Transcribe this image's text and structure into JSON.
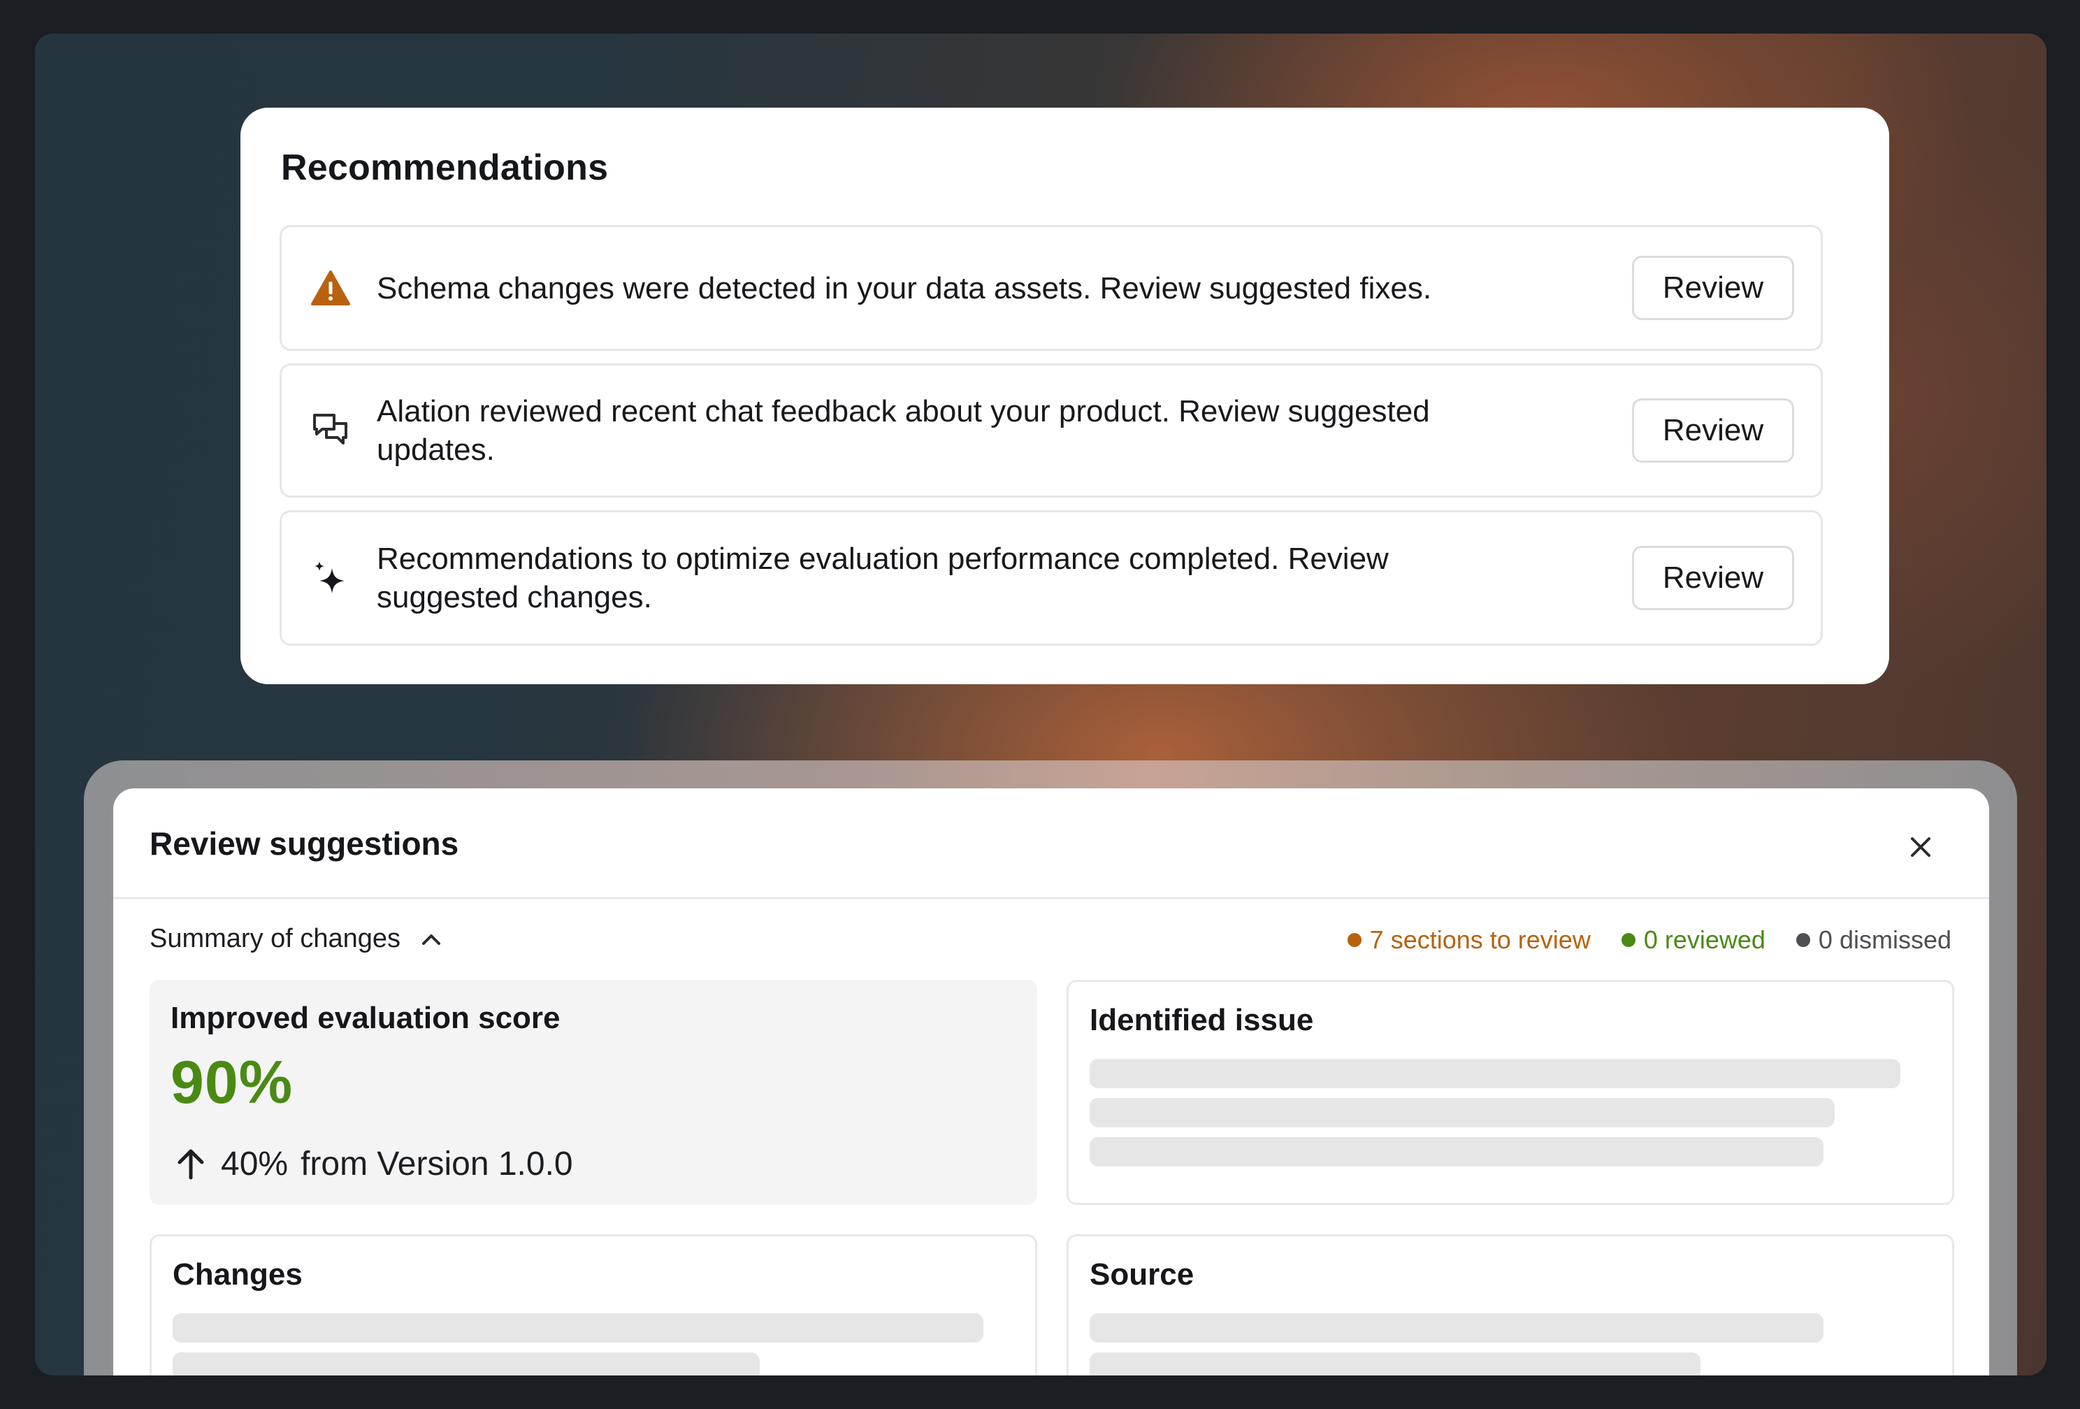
{
  "recommendations": {
    "title": "Recommendations",
    "items": [
      {
        "icon": "warning-icon",
        "text": "Schema changes were detected in your data assets. Review suggested fixes.",
        "button": "Review"
      },
      {
        "icon": "chat-bubbles-icon",
        "text": "Alation reviewed recent chat feedback about your product. Review suggested updates.",
        "button": "Review"
      },
      {
        "icon": "sparkle-icon",
        "text": "Recommendations to optimize evaluation performance completed. Review suggested changes.",
        "button": "Review"
      }
    ]
  },
  "review_panel": {
    "title": "Review suggestions",
    "summary_label": "Summary of changes",
    "stats": {
      "to_review": "7 sections to review",
      "reviewed": "0 reviewed",
      "dismissed": "0 dismissed"
    },
    "score_card": {
      "heading": "Improved evaluation score",
      "value": "90%",
      "delta": "40%",
      "delta_suffix": "from Version 1.0.0"
    },
    "issue_card": {
      "heading": "Identified issue"
    },
    "changes_card": {
      "heading": "Changes"
    },
    "source_card": {
      "heading": "Source"
    }
  },
  "colors": {
    "warning": "#b8620f",
    "to_review": "#b8620f",
    "reviewed": "#4a8a14",
    "dismissed": "#4d4f53",
    "score": "#4a8a14"
  }
}
